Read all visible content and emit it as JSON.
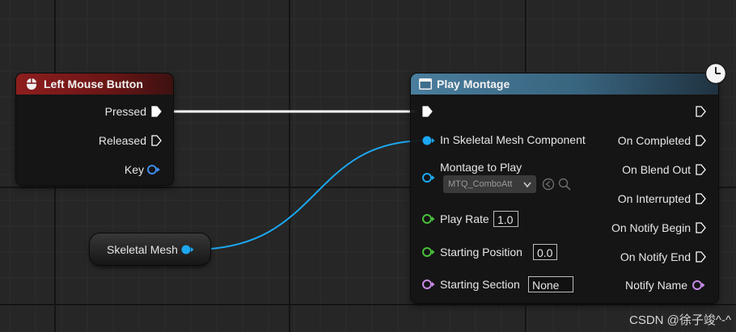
{
  "colors": {
    "exec": "#ffffff",
    "object_pin": "#1ca8f0",
    "struct_pin": "#3f8ce8",
    "float_pin": "#48c23a",
    "name_pin": "#c78be6",
    "event_header": "#7b1818",
    "function_header": "#3e6f8e",
    "background": "#262626"
  },
  "left_mouse_node": {
    "title": "Left Mouse Button",
    "icon": "mouse-icon",
    "pins": {
      "pressed": "Pressed",
      "released": "Released",
      "key": "Key"
    }
  },
  "skeletal_mesh_node": {
    "label": "Skeletal Mesh"
  },
  "play_montage_node": {
    "title": "Play Montage",
    "icon": "function-icon",
    "latent_icon": "clock-icon",
    "inputs": {
      "skeletal_mesh_component": "In Skeletal Mesh Component",
      "montage_to_play": "Montage to Play",
      "montage_value": "MTQ_ComboAtt",
      "play_rate": "Play Rate",
      "play_rate_value": "1.0",
      "starting_position": "Starting Position",
      "starting_position_value": "0.0",
      "starting_section": "Starting Section",
      "starting_section_value": "None"
    },
    "outputs": {
      "on_completed": "On Completed",
      "on_blend_out": "On Blend Out",
      "on_interrupted": "On Interrupted",
      "on_notify_begin": "On Notify Begin",
      "on_notify_end": "On Notify End",
      "notify_name": "Notify Name"
    }
  },
  "watermark": "CSDN @徐子竣^-^"
}
